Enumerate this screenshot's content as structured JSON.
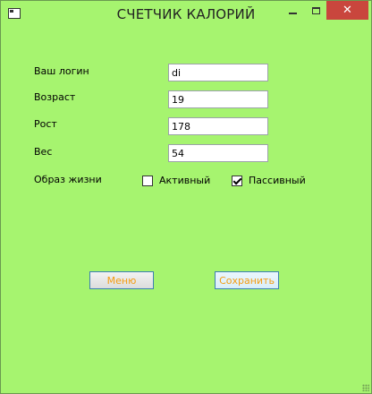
{
  "window": {
    "title": "СЧЕТЧИК КАЛОРИЙ",
    "close_glyph": "✕"
  },
  "form": {
    "login": {
      "label": "Ваш логин",
      "value": "di"
    },
    "age": {
      "label": "Возраст",
      "value": "19"
    },
    "height": {
      "label": "Рост",
      "value": "178"
    },
    "weight": {
      "label": "Вес",
      "value": "54"
    },
    "lifestyle": {
      "label": "Образ жизни",
      "options": [
        {
          "label": "Активный",
          "checked": false
        },
        {
          "label": "Пассивный",
          "checked": true
        }
      ]
    }
  },
  "buttons": {
    "menu_label": "Меню",
    "save_label": "Сохранить"
  },
  "colors": {
    "background": "#a6f46f",
    "close_button": "#c9463d",
    "button_text": "#f39c12",
    "button_border": "#3c7fb1"
  }
}
